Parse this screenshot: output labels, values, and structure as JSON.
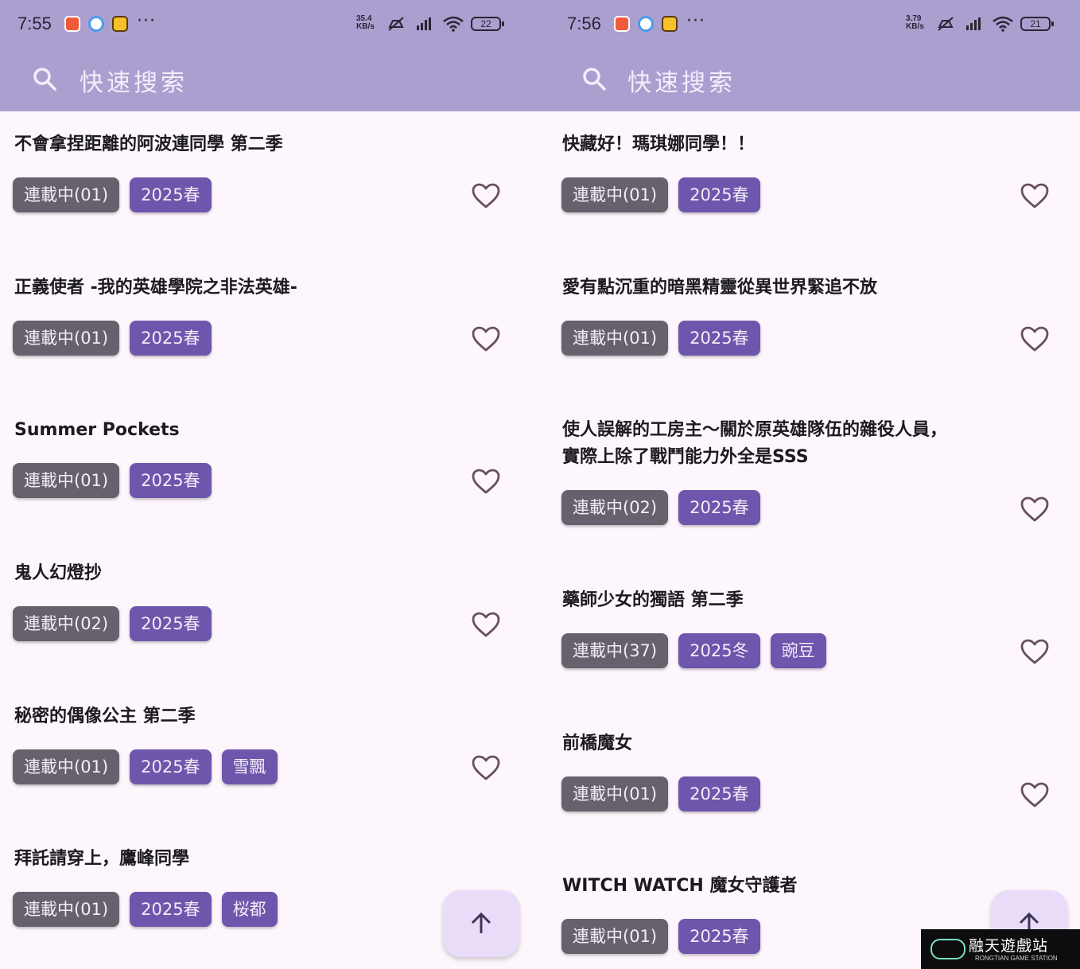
{
  "left": {
    "status": {
      "time": "7:55",
      "speed_value": "35.4",
      "speed_unit": "KB/s",
      "battery": "22"
    },
    "search": {
      "placeholder": "快速搜索"
    },
    "items": [
      {
        "title": "不會拿捏距離的阿波連同學 第二季",
        "status": "連載中(01)",
        "season": "2025春",
        "studio": ""
      },
      {
        "title": "正義使者 -我的英雄學院之非法英雄-",
        "status": "連載中(01)",
        "season": "2025春",
        "studio": ""
      },
      {
        "title": "Summer Pockets",
        "status": "連載中(01)",
        "season": "2025春",
        "studio": ""
      },
      {
        "title": "鬼人幻燈抄",
        "status": "連載中(02)",
        "season": "2025春",
        "studio": ""
      },
      {
        "title": "秘密的偶像公主 第二季",
        "status": "連載中(01)",
        "season": "2025春",
        "studio": "雪飄"
      },
      {
        "title": "拜託請穿上，鷹峰同學",
        "status": "連載中(01)",
        "season": "2025春",
        "studio": "桜都"
      }
    ]
  },
  "right": {
    "status": {
      "time": "7:56",
      "speed_value": "3.79",
      "speed_unit": "KB/s",
      "battery": "21"
    },
    "search": {
      "placeholder": "快速搜索"
    },
    "items": [
      {
        "title": "快藏好！瑪琪娜同學！！",
        "status": "連載中(01)",
        "season": "2025春",
        "studio": ""
      },
      {
        "title": "愛有點沉重的暗黑精靈從異世界緊追不放",
        "status": "連載中(01)",
        "season": "2025春",
        "studio": ""
      },
      {
        "title": "使人誤解的工房主～關於原英雄隊伍的雜役人員，實際上除了戰鬥能力外全是SSS",
        "status": "連載中(02)",
        "season": "2025春",
        "studio": ""
      },
      {
        "title": "藥師少女的獨語 第二季",
        "status": "連載中(37)",
        "season": "2025冬",
        "studio": "豌豆"
      },
      {
        "title": "前橋魔女",
        "status": "連載中(01)",
        "season": "2025春",
        "studio": ""
      },
      {
        "title": "WITCH WATCH 魔女守護者",
        "status": "連載中(01)",
        "season": "2025春",
        "studio": ""
      }
    ]
  },
  "watermark": {
    "main": "融天遊戲站",
    "sub": "RONGTIAN GAME STATION"
  },
  "colors": {
    "header": "#ab9fd0",
    "status_tag": "#66616c",
    "season_tag": "#6d56ac",
    "fab": "#e9dcf8",
    "background": "#fdf7fd"
  }
}
